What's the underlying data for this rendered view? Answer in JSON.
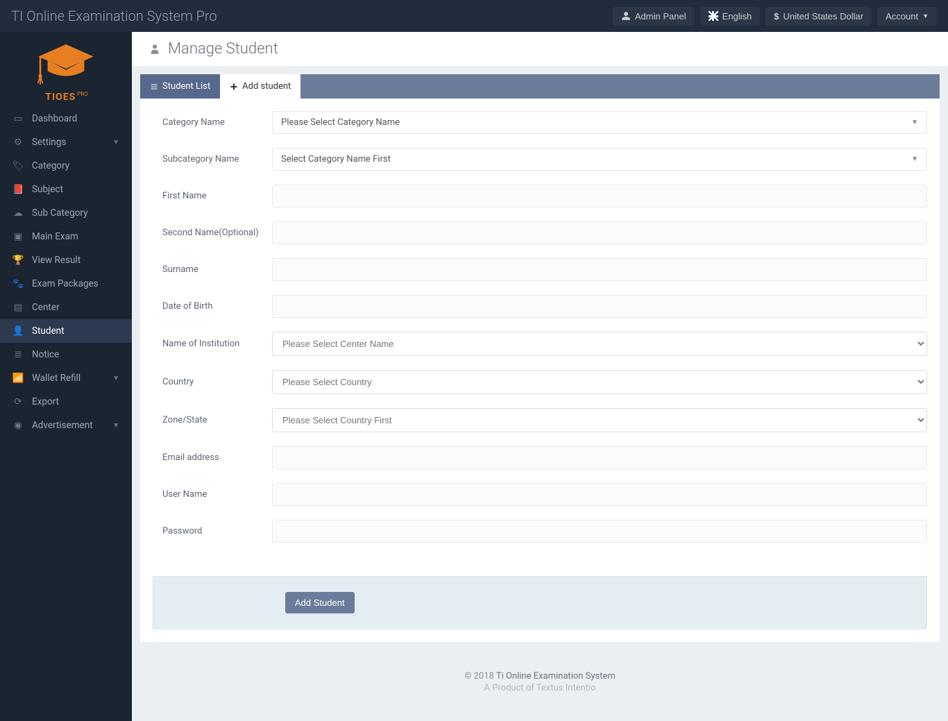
{
  "topbar": {
    "title": "TI Online Examination System Pro",
    "admin_panel": "Admin Panel",
    "language": "English",
    "currency": "United States Dollar",
    "account": "Account"
  },
  "logo": {
    "text": "TIOES",
    "pro": "PRO"
  },
  "sidebar": {
    "items": [
      {
        "label": "Dashboard"
      },
      {
        "label": "Settings",
        "caret": true
      },
      {
        "label": "Category"
      },
      {
        "label": "Subject"
      },
      {
        "label": "Sub Category"
      },
      {
        "label": "Main Exam"
      },
      {
        "label": "View Result"
      },
      {
        "label": "Exam Packages"
      },
      {
        "label": "Center"
      },
      {
        "label": "Student"
      },
      {
        "label": "Notice"
      },
      {
        "label": "Wallet Refill",
        "caret": true
      },
      {
        "label": "Export"
      },
      {
        "label": "Advertisement",
        "caret": true
      }
    ],
    "active": "Student"
  },
  "page": {
    "title": "Manage Student",
    "tabs": {
      "list": "Student List",
      "add": "Add student"
    }
  },
  "form": {
    "labels": {
      "category": "Category Name",
      "subcategory": "Subcategory Name",
      "first_name": "First Name",
      "second_name": "Second Name(Optional)",
      "surname": "Surname",
      "dob": "Date of Birth",
      "institution": "Name of Institution",
      "country": "Country",
      "zone": "Zone/State",
      "email": "Email address",
      "username": "User Name",
      "password": "Password"
    },
    "placeholders": {
      "category": "Please Select Category Name",
      "subcategory": "Select Category Name First",
      "institution": "Please Select Center Name",
      "country": "Please Select Country",
      "zone": "Please Select Country First"
    },
    "submit": "Add Student"
  },
  "footer": {
    "copyright": "© 2018 ",
    "link": "Ti Online Examination System",
    "sub": "A Product of Textus Intentio"
  }
}
